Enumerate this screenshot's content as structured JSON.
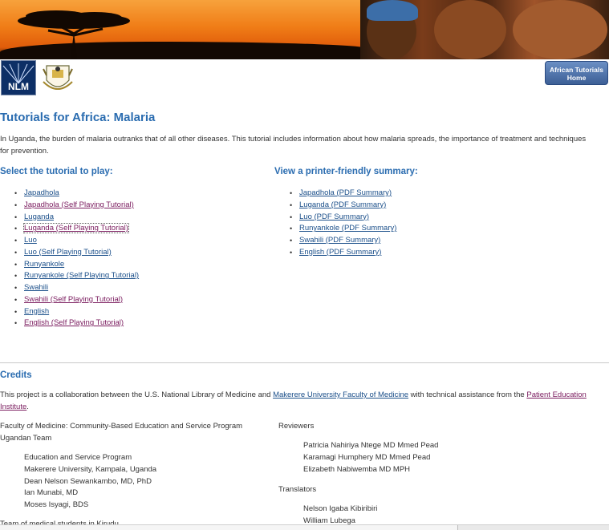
{
  "header": {
    "home_button": "African Tutorials Home",
    "nlm_logo_text": "NLM"
  },
  "page_title": "Tutorials for Africa: Malaria",
  "intro": "In Uganda, the burden of malaria outranks that of all other diseases. This tutorial includes information about how malaria spreads, the importance of treatment and techniques for prevention.",
  "tutorials": {
    "heading": "Select the tutorial to play:",
    "items": [
      {
        "label": "Japadhola",
        "state": "normal"
      },
      {
        "label": "Japadhola (Self Playing Tutorial)",
        "state": "visited"
      },
      {
        "label": "Luganda",
        "state": "normal"
      },
      {
        "label": "Luganda (Self Playing Tutorial)",
        "state": "focused"
      },
      {
        "label": "Luo",
        "state": "normal"
      },
      {
        "label": "Luo (Self Playing Tutorial)",
        "state": "normal"
      },
      {
        "label": "Runyankole",
        "state": "normal"
      },
      {
        "label": "Runyankole (Self Playing Tutorial)",
        "state": "normal"
      },
      {
        "label": "Swahili",
        "state": "normal"
      },
      {
        "label": "Swahili (Self Playing Tutorial)",
        "state": "visited"
      },
      {
        "label": "English",
        "state": "normal"
      },
      {
        "label": "English (Self Playing Tutorial)",
        "state": "visited"
      }
    ]
  },
  "summaries": {
    "heading": "View a printer-friendly summary:",
    "items": [
      {
        "label": "Japadhola (PDF Summary)"
      },
      {
        "label": "Luganda (PDF Summary)"
      },
      {
        "label": "Luo (PDF Summary)"
      },
      {
        "label": "Runyankole (PDF Summary)"
      },
      {
        "label": "Swahili (PDF Summary)"
      },
      {
        "label": "English (PDF Summary)"
      }
    ]
  },
  "credits": {
    "heading": "Credits",
    "collab_prefix": "This project is a collaboration between the U.S. National Library of Medicine and ",
    "collab_link1": "Makerere University Faculty of Medicine",
    "collab_middle": " with technical assistance from the ",
    "collab_link2": "Patient Education Institute",
    "collab_suffix": ".",
    "faculty_heading": "Faculty of Medicine: Community-Based Education and Service Program",
    "team_heading": "Ugandan Team",
    "team_members": [
      "Education and Service Program",
      "Makerere University, Kampala, Uganda",
      "Dean Nelson Sewankambo, MD, PhD",
      "Ian Munabi, MD",
      "Moses Isyagi, BDS"
    ],
    "students_heading": "Team of medical students in Kirudu",
    "reviewers_heading": "Reviewers",
    "reviewers": [
      "Patricia Nahiriya Ntege MD Mmed Pead",
      "Karamagi Humphery MD Mmed Pead",
      "Elizabeth Nabiwemba MD MPH"
    ],
    "translators_heading": "Translators",
    "translators": [
      "Nelson Igaba Kibiribiri",
      "William Lubega"
    ]
  },
  "colors": {
    "heading_blue": "#2a6cb0",
    "link": "#1b4f8a",
    "visited": "#7a1b5e",
    "banner_orange": "#f07d17"
  }
}
